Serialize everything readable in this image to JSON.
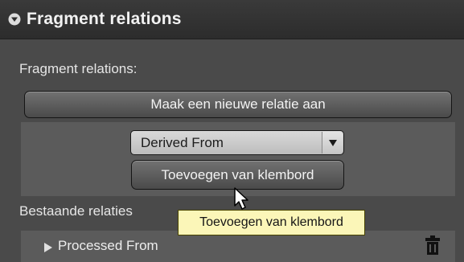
{
  "panel": {
    "title": "Fragment relations",
    "collapse_icon": "collapse-arrow-icon"
  },
  "relations": {
    "label": "Fragment relations:",
    "new_button_label": "Maak een nieuwe relatie aan",
    "type_select": {
      "selected": "Derived From"
    },
    "clipboard_button_label": "Toevoegen van klembord"
  },
  "existing": {
    "label": "Bestaande relaties",
    "items": [
      {
        "label": "Processed From",
        "icon": "trash-icon"
      }
    ]
  },
  "tooltip": {
    "text": "Toevoegen van klembord"
  },
  "colors": {
    "panel_bg": "#4a4a4a",
    "header_bg": "#2c2c2c",
    "tooltip_bg": "#fbf6b8"
  }
}
